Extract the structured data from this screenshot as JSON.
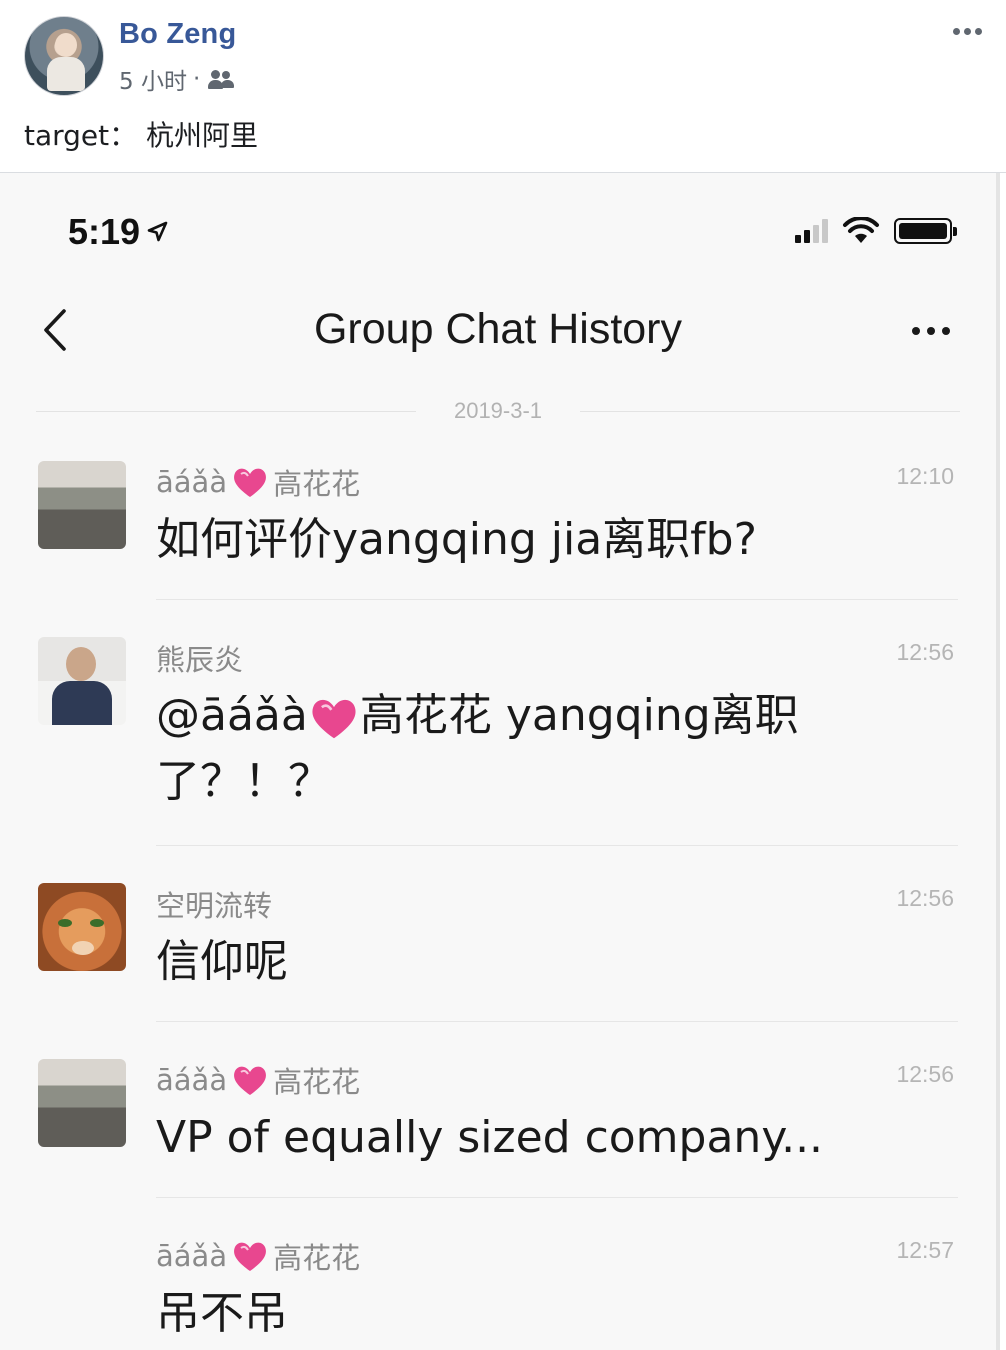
{
  "post": {
    "author": "Bo Zeng",
    "time": "5 小时",
    "separator": "·",
    "audience_icon": "friends-icon",
    "text": "target：  杭州阿里"
  },
  "phone": {
    "status_time": "5:19",
    "nav_title": "Group Chat History",
    "date": "2019-3-1",
    "messages": [
      {
        "sender_prefix": "āáǎà",
        "sender_suffix": "高花花",
        "time": "12:10",
        "text": "如何评价yangqing jia离职fb?"
      },
      {
        "sender_prefix": "熊辰炎",
        "sender_suffix": "",
        "time": "12:56",
        "text_a": "@āáǎà",
        "text_b": "高花花 yangqing离职了？！？"
      },
      {
        "sender_prefix": "空明流转",
        "sender_suffix": "",
        "time": "12:56",
        "text": "信仰呢"
      },
      {
        "sender_prefix": "āáǎà",
        "sender_suffix": "高花花",
        "time": "12:56",
        "text": "VP of equally sized company..."
      },
      {
        "sender_prefix": "āáǎà",
        "sender_suffix": "高花花",
        "time": "12:57",
        "text": "吊不吊"
      }
    ]
  },
  "colors": {
    "fb_name": "#385898",
    "heart": "#e8478f",
    "meta": "#606770"
  }
}
